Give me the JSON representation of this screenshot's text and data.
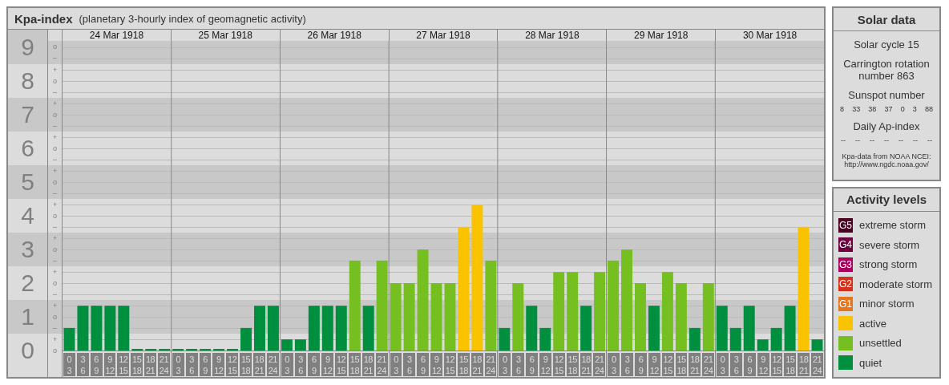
{
  "kpa": {
    "title": "Kpa-index",
    "subtitle": "(planetary 3-hourly index of geomagnetic activity)",
    "scale": [
      {
        "marks": [
          "o",
          "–"
        ]
      },
      {
        "marks": [
          "+",
          "o",
          "–"
        ]
      },
      {
        "marks": [
          "+",
          "o",
          "–"
        ]
      },
      {
        "marks": [
          "+",
          "o",
          "–"
        ]
      },
      {
        "marks": [
          "+",
          "o",
          "–"
        ]
      },
      {
        "marks": [
          "+",
          "o",
          "–"
        ]
      },
      {
        "marks": [
          "+",
          "o",
          "–"
        ]
      },
      {
        "marks": [
          "+",
          "o",
          "–"
        ]
      },
      {
        "marks": [
          "+",
          "o",
          "–"
        ]
      },
      {
        "marks": [
          "+",
          "o"
        ]
      }
    ],
    "days": [
      "24 Mar 1918",
      "25 Mar 1918",
      "26 Mar 1918",
      "27 Mar 1918",
      "28 Mar 1918",
      "29 Mar 1918",
      "30 Mar 1918"
    ],
    "chart_data": {
      "type": "bar",
      "grid": true,
      "ylim": [
        0,
        9
      ],
      "bands": [
        {
          "axis": "y",
          "from": 0.5,
          "to": 1.5
        },
        {
          "axis": "y",
          "from": 2.5,
          "to": 3.5
        },
        {
          "axis": "y",
          "from": 4.5,
          "to": 5.5
        },
        {
          "axis": "y",
          "from": 6.5,
          "to": 7.5
        },
        {
          "axis": "y",
          "from": 8.5,
          "to": 9.5
        }
      ],
      "yticks": [
        {
          "value": 9,
          "label": "9"
        },
        {
          "value": 8,
          "label": "8"
        },
        {
          "value": 7,
          "label": "7"
        },
        {
          "value": 6,
          "label": "6"
        },
        {
          "value": 5,
          "label": "5"
        },
        {
          "value": 4,
          "label": "4"
        },
        {
          "value": 3,
          "label": "3"
        },
        {
          "value": 2,
          "label": "2"
        },
        {
          "value": 1,
          "label": "1"
        },
        {
          "value": 0,
          "label": "0"
        }
      ],
      "categories": [
        "0 3",
        "3 6",
        "6 9",
        "9 12",
        "12 15",
        "15 18",
        "18 21",
        "21 24",
        "0 3",
        "3 6",
        "6 9",
        "9 12",
        "12 15",
        "15 18",
        "18 21",
        "21 24",
        "0 3",
        "3 6",
        "6 9",
        "9 12",
        "12 15",
        "15 18",
        "18 21",
        "21 24",
        "0 3",
        "3 6",
        "6 9",
        "9 12",
        "12 15",
        "15 18",
        "18 21",
        "21 24",
        "0 3",
        "3 6",
        "6 9",
        "9 12",
        "12 15",
        "15 18",
        "18 21",
        "21 24",
        "0 3",
        "3 6",
        "6 9",
        "9 12",
        "12 15",
        "15 18",
        "18 21",
        "21 24",
        "0 3",
        "3 6",
        "6 9",
        "9 12",
        "12 15",
        "15 18",
        "18 21",
        "21 24"
      ],
      "values": [
        0.67,
        1.33,
        1.33,
        1.33,
        1.33,
        0,
        0,
        0,
        0,
        0,
        0,
        0,
        0,
        0.67,
        1.33,
        1.33,
        0.33,
        0.33,
        1.33,
        1.33,
        1.33,
        2.67,
        1.33,
        2.67,
        2,
        2,
        3,
        2,
        2,
        3.67,
        4.33,
        2.67,
        0.67,
        2,
        1.33,
        0.67,
        2.33,
        2.33,
        1.33,
        2.33,
        2.67,
        3,
        2,
        1.33,
        2.33,
        2,
        0.67,
        2,
        1.33,
        0.67,
        1.33,
        0.33,
        0.67,
        1.33,
        3.67,
        0.33
      ]
    }
  },
  "solar": {
    "title": "Solar data",
    "cycle": "Solar cycle 15",
    "rotation": "Carrington rotation number 863",
    "sunspot_title": "Sunspot number",
    "sunspots": [
      "8",
      "33",
      "38",
      "37",
      "0",
      "3",
      "88"
    ],
    "ap_title": "Daily Ap-index",
    "ap": [
      "--",
      "--",
      "--",
      "--",
      "--",
      "--",
      "--"
    ],
    "source": "Kpa-data from NOAA NCEI:",
    "source_url": "http://www.ngdc.noaa.gov/"
  },
  "legend": {
    "title": "Activity levels",
    "items": [
      {
        "badge": "G5",
        "label": "extreme storm",
        "color": "#4b0021"
      },
      {
        "badge": "G4",
        "label": "severe storm",
        "color": "#6e003f"
      },
      {
        "badge": "G3",
        "label": "strong storm",
        "color": "#a8005c"
      },
      {
        "badge": "G2",
        "label": "moderate storm",
        "color": "#d4311d"
      },
      {
        "badge": "G1",
        "label": "minor storm",
        "color": "#e6761b"
      },
      {
        "label": "active",
        "color": "#f9c300"
      },
      {
        "label": "unsettled",
        "color": "#76bf21"
      },
      {
        "label": "quiet",
        "color": "#008f3e"
      }
    ]
  }
}
